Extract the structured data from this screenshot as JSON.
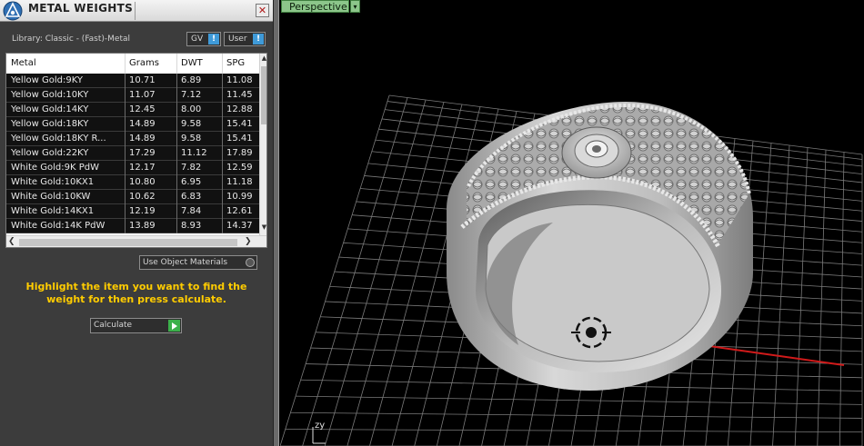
{
  "panel": {
    "title": "METAL WEIGHTS",
    "close_label": "✕",
    "library_label": "Library: Classic - (Fast)-Metal",
    "gv_label": "GV",
    "user_label": "User",
    "toggle_indicator": "!"
  },
  "table": {
    "columns": [
      "Metal",
      "Grams",
      "DWT",
      "SPG"
    ],
    "rows": [
      [
        "Yellow Gold:9KY",
        "10.71",
        "6.89",
        "11.08"
      ],
      [
        "Yellow Gold:10KY",
        "11.07",
        "7.12",
        "11.45"
      ],
      [
        "Yellow Gold:14KY",
        "12.45",
        "8.00",
        "12.88"
      ],
      [
        "Yellow Gold:18KY",
        "14.89",
        "9.58",
        "15.41"
      ],
      [
        "Yellow Gold:18KY R...",
        "14.89",
        "9.58",
        "15.41"
      ],
      [
        "Yellow Gold:22KY",
        "17.29",
        "11.12",
        "17.89"
      ],
      [
        "White Gold:9K PdW",
        "12.17",
        "7.82",
        "12.59"
      ],
      [
        "White Gold:10KX1",
        "10.80",
        "6.95",
        "11.18"
      ],
      [
        "White Gold:10KW",
        "10.62",
        "6.83",
        "10.99"
      ],
      [
        "White Gold:14KX1",
        "12.19",
        "7.84",
        "12.61"
      ],
      [
        "White Gold:14K PdW",
        "13.89",
        "8.93",
        "14.37"
      ]
    ]
  },
  "scroll": {
    "up": "▲",
    "down": "▼",
    "left": "❮",
    "right": "❯"
  },
  "options": {
    "use_object_materials_label": "Use Object Materials"
  },
  "instruction": "Highlight the item you want to find the weight for then press calculate.",
  "calculate": {
    "label": "Calculate"
  },
  "viewport": {
    "view_name": "Perspective",
    "view_dropdown_arrow": "▾",
    "axis_label": "zy"
  },
  "colors": {
    "accent_yellow": "#ffcc00",
    "view_tab": "#8cc68a",
    "toggle_blue": "#3f9ad8",
    "go_green": "#3bb04a",
    "x_axis": "#d11a1a",
    "y_axis": "#1ea8b8",
    "grid": "#7a7a7a"
  }
}
